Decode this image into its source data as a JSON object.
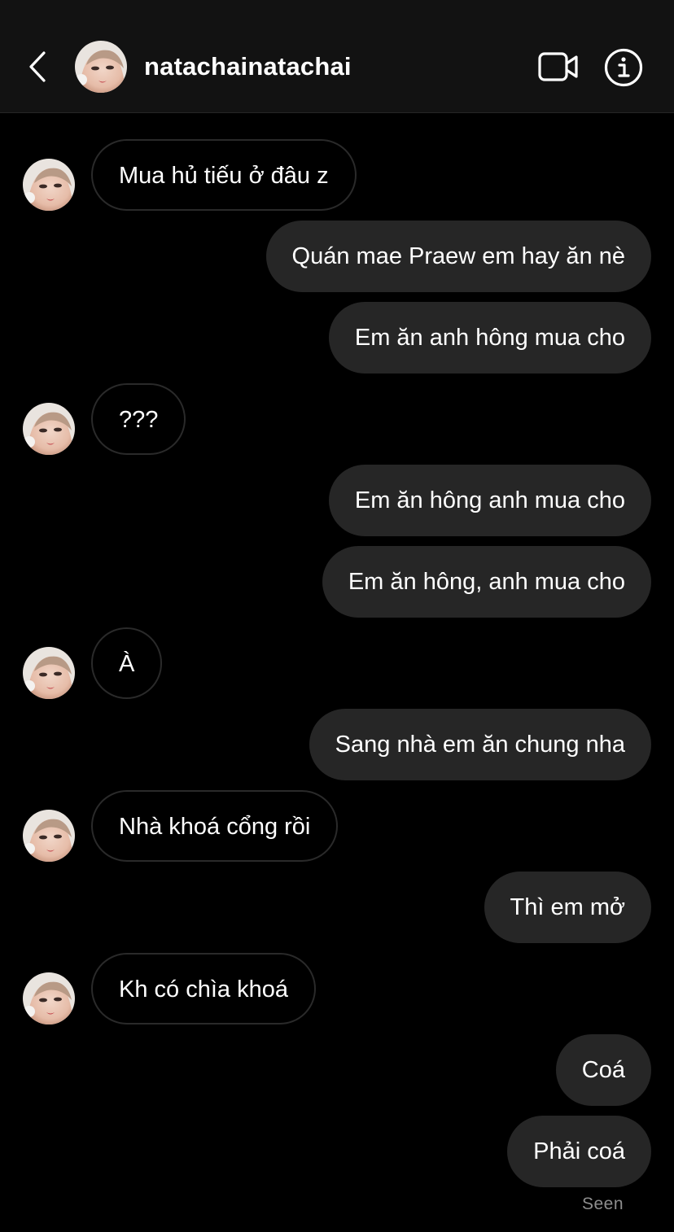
{
  "header": {
    "username": "natachainatachai",
    "icons": {
      "back": "chevron-left-icon",
      "video": "video-camera-icon",
      "info": "info-icon"
    }
  },
  "messages": [
    {
      "from": "them",
      "text": "Mua hủ tiếu ở đâu z"
    },
    {
      "from": "me",
      "text": "Quán mae Praew em hay ăn nè"
    },
    {
      "from": "me",
      "text": "Em ăn anh hông mua cho"
    },
    {
      "from": "them",
      "text": "???"
    },
    {
      "from": "me",
      "text": "Em ăn hông anh mua cho"
    },
    {
      "from": "me",
      "text": "Em ăn hông, anh mua cho"
    },
    {
      "from": "them",
      "text": "À"
    },
    {
      "from": "me",
      "text": "Sang nhà em ăn chung nha"
    },
    {
      "from": "them",
      "text": "Nhà khoá cổng rồi"
    },
    {
      "from": "me",
      "text": "Thì em mở"
    },
    {
      "from": "them",
      "text": "Kh có chìa khoá"
    },
    {
      "from": "me",
      "text": "Coá"
    },
    {
      "from": "me",
      "text": "Phải coá"
    }
  ],
  "status": {
    "seen": "Seen"
  },
  "colors": {
    "background": "#000000",
    "header_background": "#121212",
    "outgoing_bubble": "#262626",
    "incoming_border": "#2a2a2a",
    "seen_text": "#8e8e8e"
  }
}
